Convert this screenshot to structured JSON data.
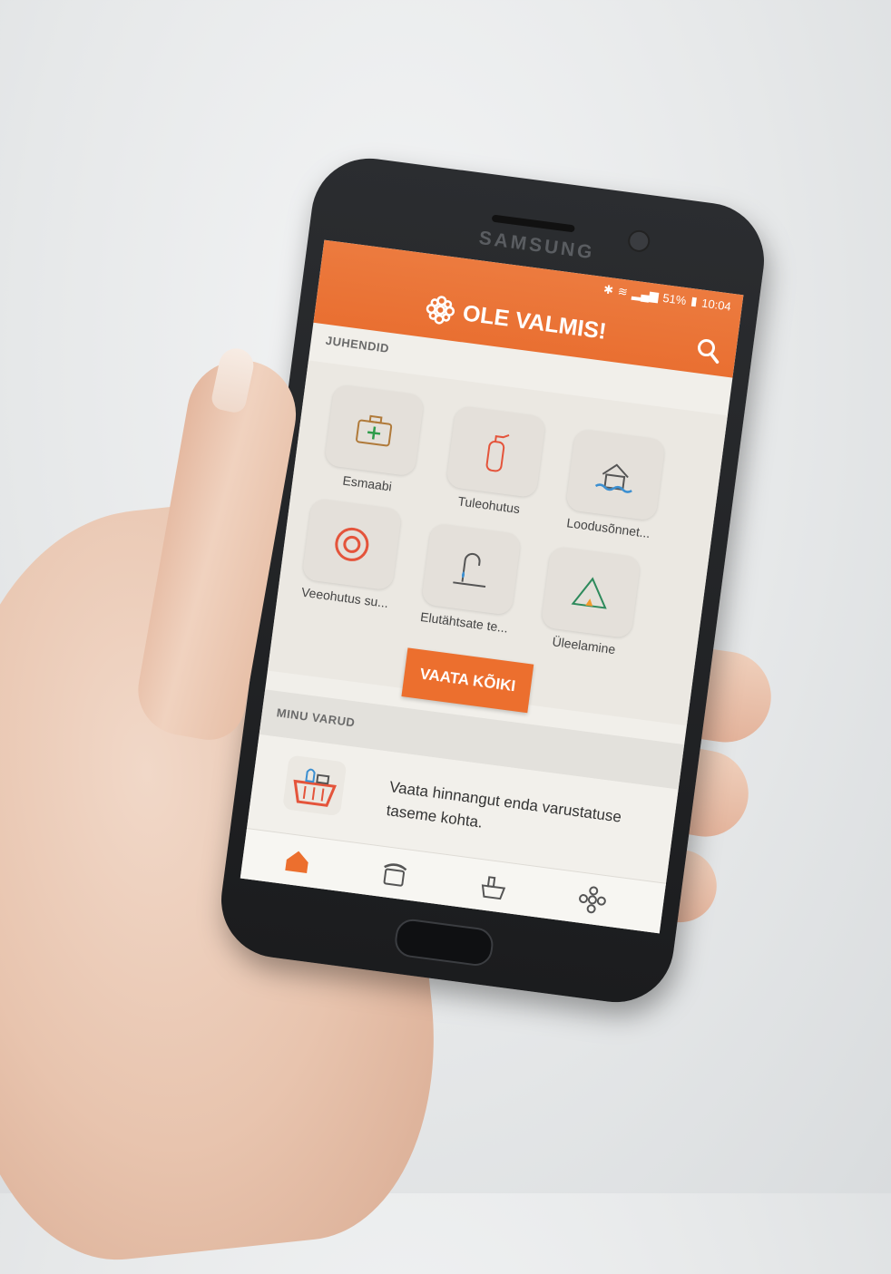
{
  "status_bar": {
    "battery": "51%",
    "time": "10:04"
  },
  "phone": {
    "brand": "SAMSUNG"
  },
  "app": {
    "title": "OLE VALMIS!"
  },
  "guides": {
    "section_label": "JUHENDID",
    "items": [
      {
        "label": "Esmaabi",
        "icon": "first-aid-kit-icon"
      },
      {
        "label": "Tuleohutus",
        "icon": "fire-extinguisher-icon"
      },
      {
        "label": "Loodusõnnet...",
        "icon": "flooded-house-icon"
      },
      {
        "label": "Veeohutus su...",
        "icon": "lifebuoy-icon"
      },
      {
        "label": "Elutähtsate te...",
        "icon": "water-tap-icon"
      },
      {
        "label": "Üleelamine",
        "icon": "tent-icon"
      }
    ],
    "view_all_label": "VAATA KÕIKI"
  },
  "supplies": {
    "section_label": "MINU VARUD",
    "text": "Vaata hinnangut enda varustatuse taseme kohta."
  },
  "bottom_nav": [
    {
      "name": "home-icon",
      "active": true
    },
    {
      "name": "phone-icon",
      "active": false
    },
    {
      "name": "basket-icon",
      "active": false
    },
    {
      "name": "settings-icon",
      "active": false
    }
  ],
  "colors": {
    "accent": "#ec6f2e",
    "screen_bg": "#f1efea"
  }
}
